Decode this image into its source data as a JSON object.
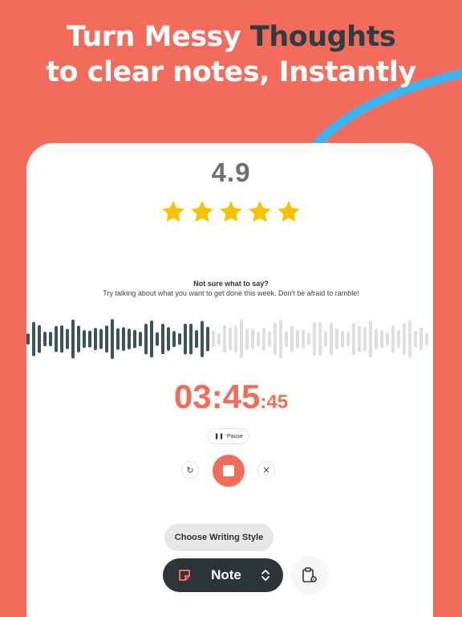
{
  "headline": {
    "line1_part1": "Turn Messy ",
    "line1_part2": "Thoughts",
    "line2": "to clear notes, Instantly"
  },
  "rating": {
    "value": "4.9",
    "stars": 5
  },
  "prompt": {
    "title": "Not sure what to say?",
    "body": "Try talking about what you want to get done this week. Don't be afraid to ramble!"
  },
  "timer": {
    "main": "03:45",
    "fraction": ":45"
  },
  "controls": {
    "pause_label": "Pause"
  },
  "writing_style": {
    "button_label": "Choose Writing Style",
    "selected": "Note"
  },
  "colors": {
    "background": "#f26b5b",
    "accent_blue": "#3ab4f2",
    "wave_recorded": "#3d5559",
    "wave_pending": "#dedede",
    "star": "#f5c400",
    "dark": "#2d3538"
  }
}
